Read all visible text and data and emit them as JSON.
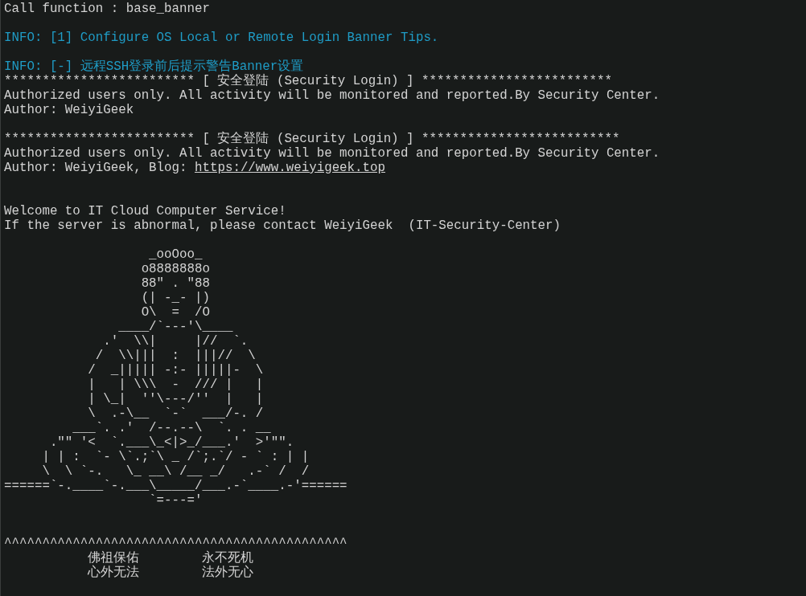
{
  "terminal": {
    "lines": [
      {
        "kind": "plain",
        "text": "Call function : base_banner"
      },
      {
        "kind": "blank"
      },
      {
        "kind": "info",
        "text": "INFO: [1] Configure OS Local or Remote Login Banner Tips."
      },
      {
        "kind": "blank"
      },
      {
        "kind": "info",
        "text": "INFO: [-] 远程SSH登录前后提示警告Banner设置"
      },
      {
        "kind": "plain",
        "text": "************************* [ 安全登陆 (Security Login) ] *************************"
      },
      {
        "kind": "plain",
        "text": "Authorized users only. All activity will be monitored and reported.By Security Center."
      },
      {
        "kind": "plain",
        "text": "Author: WeiyiGeek"
      },
      {
        "kind": "blank"
      },
      {
        "kind": "plain",
        "text": "************************* [ 安全登陆 (Security Login) ] **************************"
      },
      {
        "kind": "plain",
        "text": "Authorized users only. All activity will be monitored and reported.By Security Center."
      },
      {
        "kind": "link",
        "text": "Author: WeiyiGeek, Blog: ",
        "link": "https://www.weiyigeek.top"
      },
      {
        "kind": "blank"
      },
      {
        "kind": "blank"
      },
      {
        "kind": "plain",
        "text": "Welcome to IT Cloud Computer Service!"
      },
      {
        "kind": "plain",
        "text": "If the server is abnormal, please contact WeiyiGeek  (IT-Security-Center)"
      },
      {
        "kind": "blank"
      },
      {
        "kind": "art",
        "art": [
          "                   _ooOoo_",
          "                  o8888888o",
          "                  88\" . \"88",
          "                  (| -_- |)",
          "                  O\\  =  /O",
          "               ____/`---'\\____",
          "             .'  \\\\|     |//  `.",
          "            /  \\\\|||  :  |||//  \\",
          "           /  _||||| -:- |||||-  \\",
          "           |   | \\\\\\  -  /// |   |",
          "           | \\_|  ''\\---/''  |   |",
          "           \\  .-\\__  `-`  ___/-. /",
          "         ___`. .'  /--.--\\  `. . __",
          "      .\"\" '<  `.___\\_<|>_/___.'  >'\"\".",
          "     | | :  `- \\`.;`\\ _ /`;.`/ - ` : | |",
          "     \\  \\ `-.   \\_ __\\ /__ _/   .-` /  /",
          "======`-.____`-.___\\_____/___.-`____.-'======",
          "                   `=---='"
        ]
      },
      {
        "kind": "blank"
      },
      {
        "kind": "blank"
      },
      {
        "kind": "plain",
        "text": "^^^^^^^^^^^^^^^^^^^^^^^^^^^^^^^^^^^^^^^^^^^^^"
      },
      {
        "kind": "verse",
        "parts": [
          "佛祖保佑",
          "永不死机"
        ]
      },
      {
        "kind": "verse",
        "parts": [
          "心外无法",
          "法外无心"
        ]
      }
    ]
  }
}
